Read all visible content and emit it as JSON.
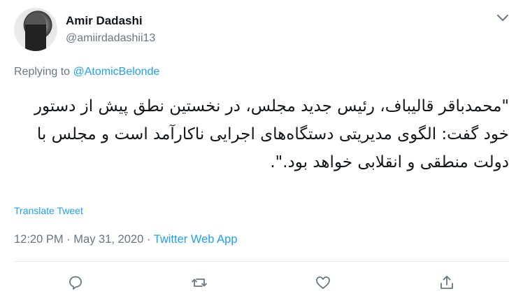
{
  "author": {
    "display_name": "Amir Dadashi",
    "handle": "@amiirdadashii13"
  },
  "reply": {
    "prefix": "Replying to ",
    "to": "@AtomicBelonde"
  },
  "tweet": {
    "text": "\"محمدباقر قالیباف، رئیس جدید مجلس، در نخستین نطق پیش از دستور خود گفت: الگوی مدیریتی دستگاه‌های اجرایی ناکارآمد است و مجلس با دولت منطقی و انقلابی خواهد بود.\".",
    "translate_label": "Translate Tweet"
  },
  "meta": {
    "time": "12:20 PM",
    "sep1": " · ",
    "date": "May 31, 2020",
    "sep2": " · ",
    "source": "Twitter Web App"
  },
  "icons": {
    "more": "chevron-down-icon",
    "reply": "comment-icon",
    "retweet": "retweet-icon",
    "like": "heart-icon",
    "share": "share-icon"
  },
  "colors": {
    "accent": "#1da1f2",
    "secondary_text": "#657786",
    "icon": "#657786"
  }
}
